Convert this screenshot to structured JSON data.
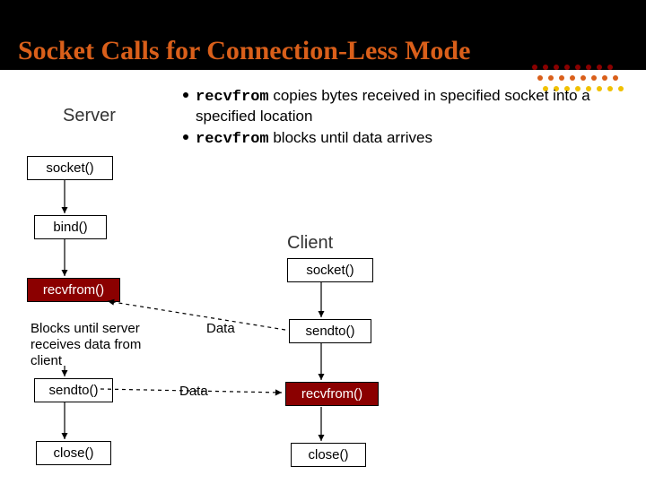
{
  "title": "Socket Calls for Connection-Less Mode",
  "server_label": "Server",
  "client_label": "Client",
  "bullets": {
    "b1_code": "recvfrom",
    "b1_rest": " copies bytes received in specified socket into a specified location",
    "b2_code": "recvfrom",
    "b2_rest": " blocks until data arrives"
  },
  "server_boxes": {
    "socket": "socket()",
    "bind": "bind()",
    "recvfrom": "recvfrom()",
    "sendto": "sendto()",
    "close": "close()"
  },
  "client_boxes": {
    "socket": "socket()",
    "sendto": "sendto()",
    "recvfrom": "recvfrom()",
    "close": "close()"
  },
  "note": "Blocks until server receives data from client",
  "data_label_1": "Data",
  "data_label_2": "Data"
}
